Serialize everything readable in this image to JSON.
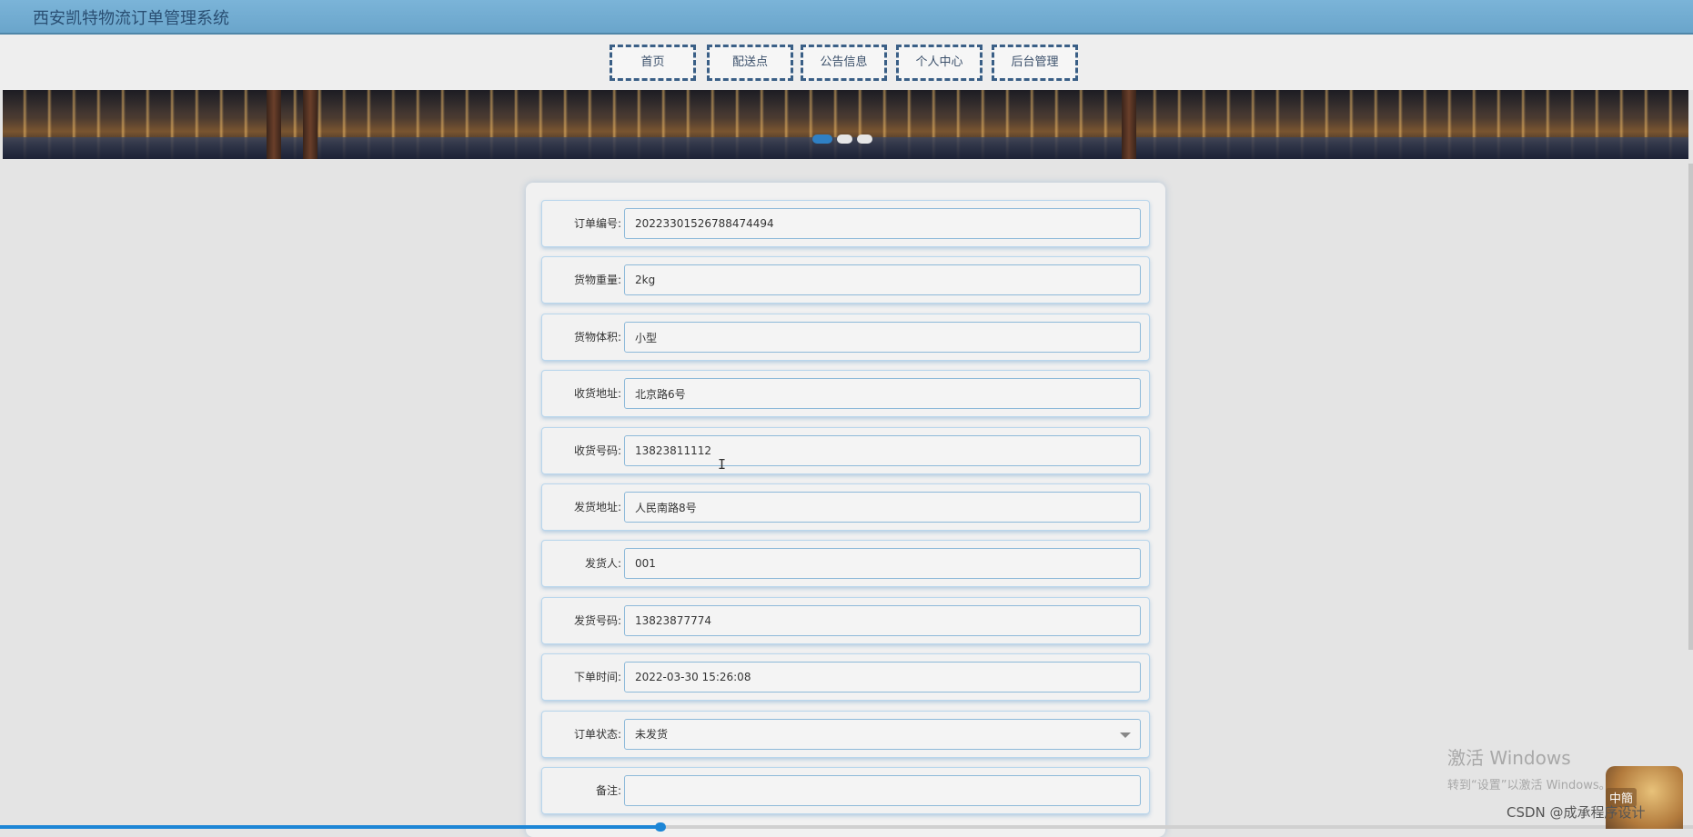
{
  "app": {
    "title": "西安凯特物流订单管理系统"
  },
  "nav": {
    "items": [
      {
        "label": "首页"
      },
      {
        "label": "配送点"
      },
      {
        "label": "公告信息"
      },
      {
        "label": "个人中心"
      },
      {
        "label": "后台管理"
      }
    ]
  },
  "banner": {
    "slide_count": 3,
    "active_slide": 1
  },
  "form": {
    "fields": [
      {
        "label": "订单编号:",
        "value": "20223301526788474494"
      },
      {
        "label": "货物重量:",
        "value": "2kg"
      },
      {
        "label": "货物体积:",
        "value": "小型"
      },
      {
        "label": "收货地址:",
        "value": "北京路6号"
      },
      {
        "label": "收货号码:",
        "value": "13823811112"
      },
      {
        "label": "发货地址:",
        "value": "人民南路8号"
      },
      {
        "label": "发货人:",
        "value": "001"
      },
      {
        "label": "发货号码:",
        "value": "13823877774"
      },
      {
        "label": "下单时间:",
        "value": "2022-03-30 15:26:08"
      },
      {
        "label": "订单状态:",
        "value": "未发货"
      },
      {
        "label": "备注:",
        "value": ""
      }
    ]
  },
  "progress": {
    "fraction": 0.39
  },
  "overlay": {
    "activate_line1": "激活 Windows",
    "activate_line2": "转到“设置”以激活 Windows。",
    "csdn": "CSDN @成承程序设计",
    "ime_label": "中簡",
    "cursor_glyph": "I"
  },
  "colors": {
    "accent": "#2f80c4",
    "nav_border": "#3a5f86",
    "field_border": "#8db9d9",
    "topbar": "#7bb4d8"
  }
}
